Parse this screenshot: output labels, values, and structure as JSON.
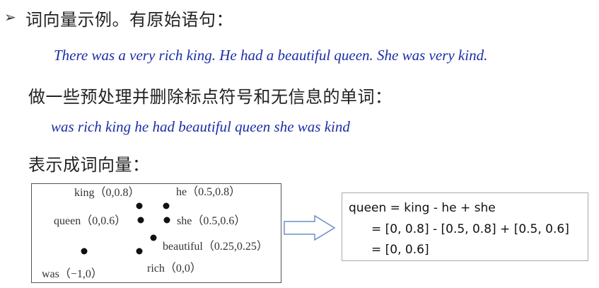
{
  "bullet": "➢",
  "headings": {
    "h1": "词向量示例。有原始语句：",
    "h2": "做一些预处理并删除标点符号和无信息的单词：",
    "h3": "表示成词向量："
  },
  "sentences": {
    "original": "There was a very rich king. He had a beautiful queen. She was very kind.",
    "processed": "was rich king he had beautiful queen she was kind"
  },
  "points": [
    {
      "word": "king",
      "label": "king（0,0.8）"
    },
    {
      "word": "he",
      "label": "he（0.5,0.8）"
    },
    {
      "word": "queen",
      "label": "queen（0,0.6）"
    },
    {
      "word": "she",
      "label": "she（0.5,0.6）"
    },
    {
      "word": "beautiful",
      "label": "beautiful（0.25,0.25）"
    },
    {
      "word": "rich",
      "label": "rich（0,0）"
    },
    {
      "word": "was",
      "label": "was（−1,0）"
    }
  ],
  "equation": {
    "line1": "queen = king - he + she",
    "line2": "= [0, 0.8] - [0.5, 0.8] + [0.5, 0.6]",
    "line3": "= [0, 0.6]"
  },
  "colors": {
    "sentence": "#1a2ea6",
    "arrow": "#6a8fc8"
  },
  "icons": {
    "arrow": "right-arrow-outline-icon",
    "bullet": "arrow-bullet-icon"
  }
}
